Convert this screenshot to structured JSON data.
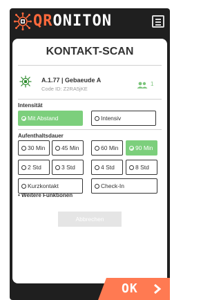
{
  "header": {
    "logo_part1": "QR",
    "logo_part2": "ONITON",
    "logo_icon": "virus-icon",
    "menu_icon": "menu-icon"
  },
  "page": {
    "title": "KONTAKT-SCAN"
  },
  "room": {
    "title": "A.1.77 | Gebaeude A",
    "code": "Code ID: Z2RA5jKE",
    "people_count": "1"
  },
  "intensity": {
    "label": "Intensität",
    "options": [
      {
        "label": "Mit Abstand",
        "selected": true
      },
      {
        "label": "Intensiv",
        "selected": false
      }
    ]
  },
  "duration": {
    "label": "Aufenthaltsdauer",
    "options": [
      {
        "label": "30 Min",
        "selected": false
      },
      {
        "label": "45 Min",
        "selected": false
      },
      {
        "label": "60 Min",
        "selected": false
      },
      {
        "label": "90 Min",
        "selected": true
      },
      {
        "label": "2 Std",
        "selected": false
      },
      {
        "label": "3 Std",
        "selected": false
      },
      {
        "label": "4 Std",
        "selected": false
      },
      {
        "label": "8 Std",
        "selected": false
      },
      {
        "label": "Kurzkontakt",
        "selected": false
      },
      {
        "label": "Check-In",
        "selected": false
      }
    ]
  },
  "more": {
    "label": "Weitere Funktionen"
  },
  "actions": {
    "cancel_label": "Abbrechen",
    "ok_label": "OK"
  },
  "colors": {
    "accent_orange": "#ff7a52",
    "selected_green": "#7ccf7c",
    "frame_dark": "#1f1f1f"
  }
}
